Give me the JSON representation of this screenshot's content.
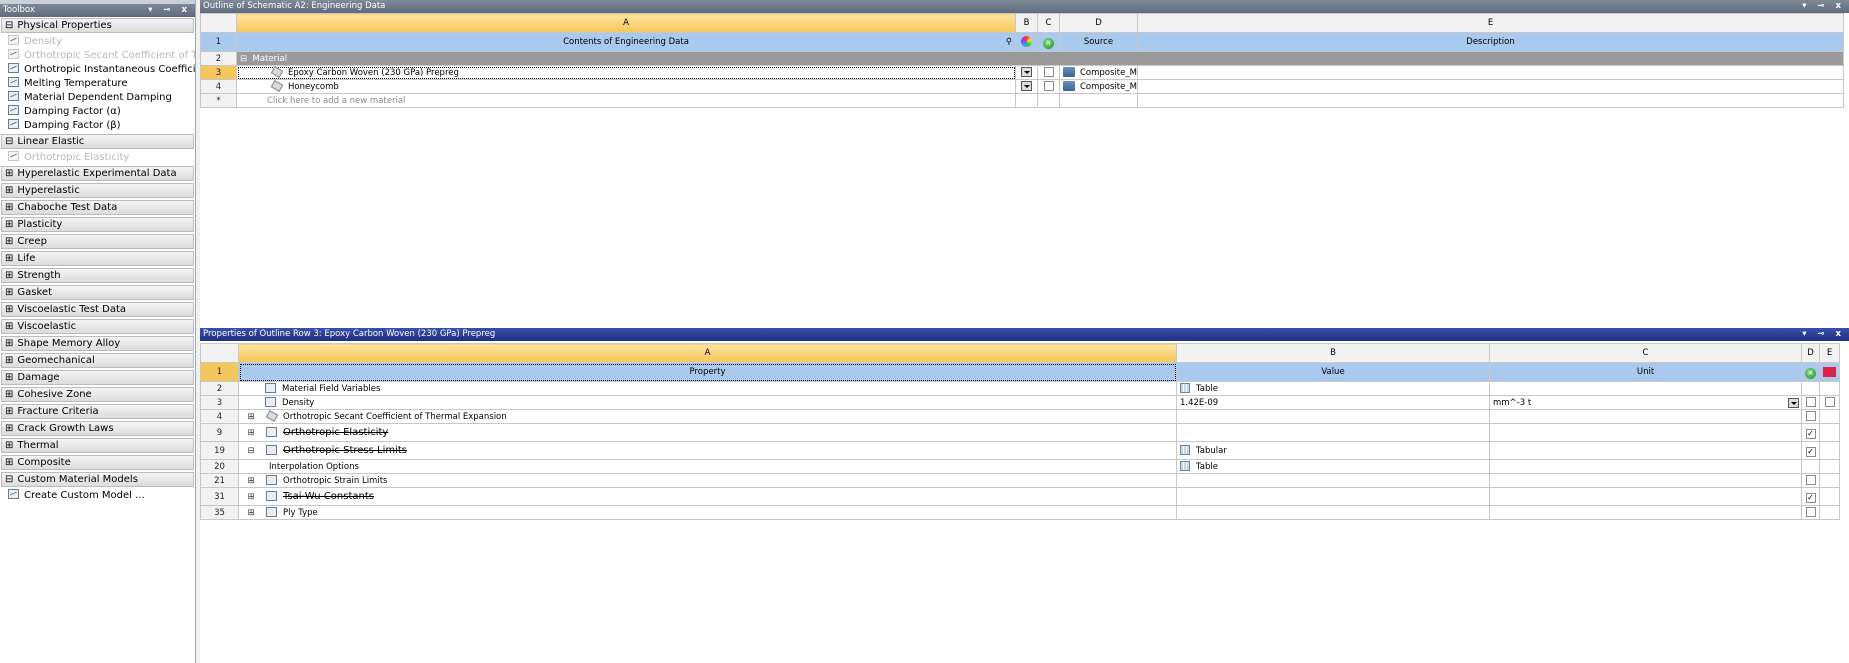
{
  "toolbox": {
    "title": "Toolbox",
    "controls": "▾ ⊸ x",
    "categories": [
      {
        "label": "Physical Properties",
        "expanded": true
      },
      {
        "label": "Linear Elastic",
        "expanded": true
      },
      {
        "label": "Hyperelastic Experimental Data"
      },
      {
        "label": "Hyperelastic"
      },
      {
        "label": "Chaboche Test Data"
      },
      {
        "label": "Plasticity"
      },
      {
        "label": "Creep"
      },
      {
        "label": "Life"
      },
      {
        "label": "Strength"
      },
      {
        "label": "Gasket"
      },
      {
        "label": "Viscoelastic Test Data"
      },
      {
        "label": "Viscoelastic"
      },
      {
        "label": "Shape Memory Alloy"
      },
      {
        "label": "Geomechanical"
      },
      {
        "label": "Damage"
      },
      {
        "label": "Cohesive Zone"
      },
      {
        "label": "Fracture Criteria"
      },
      {
        "label": "Crack Growth Laws"
      },
      {
        "label": "Thermal"
      },
      {
        "label": "Composite"
      },
      {
        "label": "Custom Material Models",
        "expanded": true
      }
    ],
    "physical_items": [
      {
        "label": "Density",
        "disabled": true
      },
      {
        "label": "Orthotropic Secant Coefficient of Th",
        "disabled": true
      },
      {
        "label": "Orthotropic Instantaneous Coefficie"
      },
      {
        "label": "Melting Temperature"
      },
      {
        "label": "Material Dependent Damping"
      },
      {
        "label": "Damping Factor (α)"
      },
      {
        "label": "Damping Factor (β)"
      }
    ],
    "linear_items": [
      {
        "label": "Orthotropic Elasticity",
        "disabled": true
      }
    ],
    "custom_items": [
      {
        "label": "Create Custom Model ..."
      }
    ]
  },
  "outline": {
    "title": "Outline of Schematic A2: Engineering Data",
    "controls": "▾ ⊸ x",
    "columns": [
      "A",
      "B",
      "C",
      "D",
      "E"
    ],
    "header_row": {
      "num": "1",
      "a": "Contents of Engineering Data",
      "d": "Source",
      "e": "Description"
    },
    "section": {
      "num": "2",
      "label": "Material"
    },
    "rows": [
      {
        "num": "3",
        "name": "Epoxy Carbon Woven (230 GPa) Prepreg",
        "source": "Composite_Ma"
      },
      {
        "num": "4",
        "name": "Honeycomb",
        "source": "Composite_Ma"
      }
    ],
    "add_row": {
      "num": "*",
      "label": "Click here to add a new material"
    }
  },
  "props": {
    "title": "Properties of Outline Row 3: Epoxy Carbon Woven (230 GPa) Prepreg",
    "controls": "▾ ⊸ x",
    "columns": [
      "A",
      "B",
      "C",
      "D",
      "E"
    ],
    "header_row": {
      "num": "1",
      "a": "Property",
      "b": "Value",
      "c": "Unit"
    },
    "rows": [
      {
        "num": "2",
        "name": "Material Field Variables",
        "value": "Table"
      },
      {
        "num": "3",
        "name": "Density",
        "value": "1.42E-09",
        "unit": "mm^-3 t"
      },
      {
        "num": "4",
        "name": "Orthotropic Secant Coefficient of Thermal Expansion"
      },
      {
        "num": "9",
        "name": "Orthotropic Elasticity"
      },
      {
        "num": "19",
        "name": "Orthotropic Stress Limits",
        "value": "Tabular"
      },
      {
        "num": "20",
        "name": "Interpolation Options",
        "value": "Table"
      },
      {
        "num": "21",
        "name": "Orthotropic Strain Limits"
      },
      {
        "num": "31",
        "name": "Tsai-Wu Constants"
      },
      {
        "num": "35",
        "name": "Ply Type"
      }
    ],
    "expand_glyphs": {
      "plus": "⊞",
      "minus": "⊟"
    },
    "check_mark": "✓"
  },
  "colors": {
    "titlebar": "#5f6b7a",
    "props_titlebar": "#1f2f82",
    "selected_header": "#f5c65b",
    "row_header_blue": "#a9c9ef"
  }
}
